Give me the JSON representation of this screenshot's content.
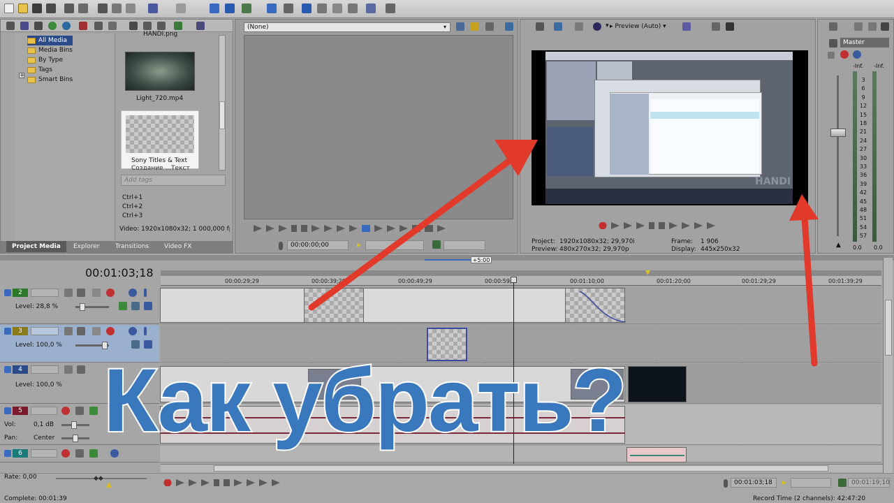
{
  "explorer": {
    "tree": [
      "All Media",
      "Media Bins",
      "By Type",
      "Tags",
      "Smart Bins"
    ],
    "media": [
      {
        "name": "HANDI.png"
      },
      {
        "name": "Light_720.mp4"
      },
      {
        "name": "Sony Titles & Text"
      },
      {
        "name": "Создание ...Текст"
      }
    ],
    "tags_placeholder": "Add tags",
    "shortcuts": [
      "Ctrl+1",
      "Ctrl+2",
      "Ctrl+3"
    ],
    "video_info": "Video: 1920x1080x32; 1 000,000 fps",
    "tabs": [
      "Project Media",
      "Explorer",
      "Transitions",
      "Video FX"
    ]
  },
  "trimmer": {
    "dropdown": "(None)",
    "timecode": "00:00:00;00"
  },
  "preview": {
    "mode": "Preview (Auto)",
    "project_label": "Project:",
    "project_value": "1920x1080x32; 29,970i",
    "preview_label": "Preview:",
    "preview_value": "480x270x32; 29,970p",
    "frame_label": "Frame:",
    "frame_value": "1 906",
    "display_label": "Display:",
    "display_value": "445x250x32",
    "inner_logo": "HANDI"
  },
  "mixer": {
    "master": "Master",
    "inf_left": "-Inf.",
    "inf_right": "-Inf.",
    "scale": [
      "3",
      "6",
      "9",
      "12",
      "15",
      "18",
      "21",
      "24",
      "27",
      "30",
      "33",
      "36",
      "39",
      "42",
      "45",
      "48",
      "51",
      "54",
      "57"
    ],
    "bottom_left": "0.0",
    "bottom_right": "0.0"
  },
  "timeline": {
    "timecode": "00:01:03;18",
    "zoom_label": "+5:00",
    "ruler": [
      "00:00:29;29",
      "00:00:39;29",
      "00:00:49;29",
      "00:00:59;2",
      "00:01:10;00",
      "00:01:20;00",
      "00:01:29;29",
      "00:01:39;29"
    ],
    "tracks": [
      {
        "num": "2",
        "level": "Level: 28,8 %"
      },
      {
        "num": "3",
        "level": "Level: 100,0 %"
      },
      {
        "num": "4",
        "level": "Level: 100,0 %"
      },
      {
        "num": "5",
        "vol": "Vol:",
        "vol_value": "0,1 dB",
        "pan": "Pan:",
        "pan_value": "Center"
      },
      {
        "num": "6"
      }
    ],
    "rate": "Rate: 0,00",
    "complete": "Complete: 00:01:39",
    "cursor_time": "00:01:03;18",
    "end_time": "00:01:19;10",
    "record_time": "Record Time (2 channels): 42:47:20"
  },
  "overlay": {
    "headline": "Как убрать?"
  },
  "colors": {
    "headline": "#3a78be",
    "arrow": "#e23a2a"
  }
}
